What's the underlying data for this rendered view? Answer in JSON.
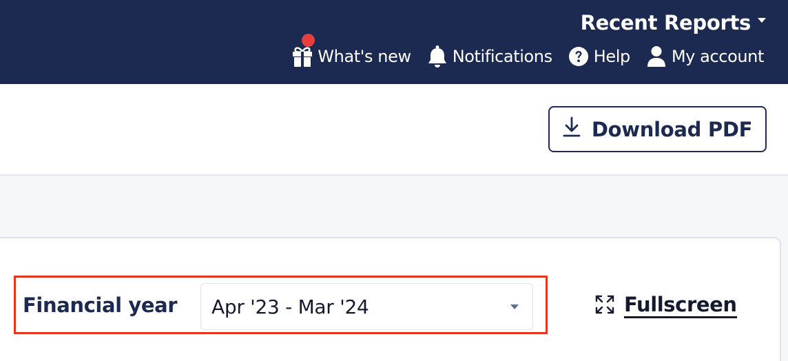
{
  "header": {
    "recent_reports": "Recent Reports",
    "nav": [
      {
        "label": "What's new",
        "icon": "gift-icon",
        "has_badge": true
      },
      {
        "label": "Notifications",
        "icon": "bell-icon"
      },
      {
        "label": "Help",
        "icon": "question-circle-icon"
      },
      {
        "label": "My account",
        "icon": "user-icon"
      }
    ]
  },
  "toolbar": {
    "download_label": "Download PDF",
    "download_icon": "download-icon"
  },
  "filter": {
    "label": "Financial year",
    "selected": "Apr '23 - Mar '24"
  },
  "fullscreen": {
    "label": "Fullscreen",
    "icon": "expand-icon"
  },
  "colors": {
    "header_bg": "#1c2a52",
    "badge": "#e5403c",
    "highlight": "#e4361c"
  }
}
